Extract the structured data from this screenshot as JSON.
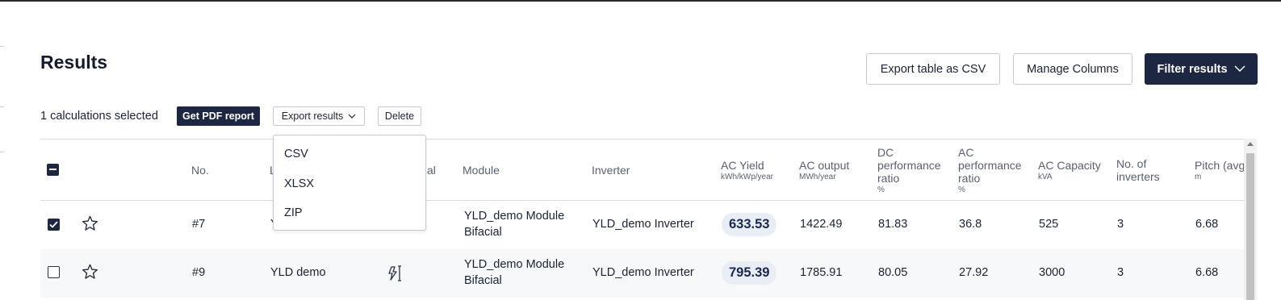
{
  "page": {
    "title": "Results"
  },
  "toolbar": {
    "export_csv_label": "Export table as CSV",
    "manage_columns_label": "Manage Columns",
    "filter_results_label": "Filter results"
  },
  "selection": {
    "count_text": "1 calculations selected",
    "pdf_report_label": "Get PDF report",
    "export_results_label": "Export results",
    "delete_label": "Delete"
  },
  "export_menu": {
    "items": [
      "CSV",
      "XLSX",
      "ZIP"
    ]
  },
  "table": {
    "headers": {
      "no": "No.",
      "hidden_label_fragment": "L",
      "hidden_type_fragment": "al",
      "module": "Module",
      "inverter": "Inverter",
      "ac_yield": "AC Yield",
      "ac_yield_unit": "kWh/kWp/year",
      "ac_output": "AC output",
      "ac_output_unit": "MWh/year",
      "dc_pr_1": "DC",
      "dc_pr_2": "performance",
      "dc_pr_3": "ratio",
      "dc_pr_unit": "%",
      "ac_pr_1": "AC",
      "ac_pr_2": "performance",
      "ac_pr_3": "ratio",
      "ac_pr_unit": "%",
      "ac_capacity": "AC Capacity",
      "ac_capacity_unit": "kVA",
      "inverters_1": "No. of",
      "inverters_2": "inverters",
      "pitch": "Pitch (avg",
      "pitch_unit": "m"
    },
    "rows": [
      {
        "checked": true,
        "no": "#7",
        "label_fragment": "Y",
        "module_1": "YLD_demo Module",
        "module_2": "Bifacial",
        "inverter": "YLD_demo Inverter",
        "ac_yield": "633.53",
        "ac_output": "1422.49",
        "dc_pr": "81.83",
        "ac_pr": "36.8",
        "ac_capacity": "525",
        "inverters": "3",
        "pitch": "6.68"
      },
      {
        "checked": false,
        "no": "#9",
        "label": "YLD demo",
        "module_1": "YLD_demo Module",
        "module_2": "Bifacial",
        "inverter": "YLD_demo Inverter",
        "ac_yield": "795.39",
        "ac_output": "1785.91",
        "dc_pr": "80.05",
        "ac_pr": "27.92",
        "ac_capacity": "3000",
        "inverters": "3",
        "pitch": "6.68"
      }
    ]
  },
  "colors": {
    "primary_dark": "#1d2741",
    "yield_pill": "#e9eef6"
  }
}
